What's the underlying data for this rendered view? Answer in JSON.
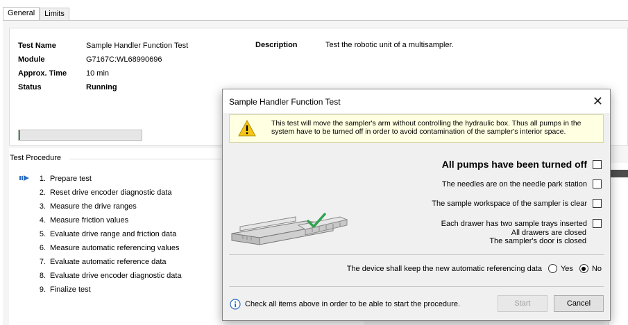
{
  "tabs": [
    {
      "label": "General",
      "active": true
    },
    {
      "label": "Limits",
      "active": false
    }
  ],
  "info": {
    "test_name_label": "Test Name",
    "test_name_value": "Sample Handler Function Test",
    "module_label": "Module",
    "module_value": "G7167C:WL68990696",
    "time_label": "Approx. Time",
    "time_value": "10 min",
    "status_label": "Status",
    "status_value": "Running",
    "description_label": "Description",
    "description_value": "Test the robotic unit of a multisampler.",
    "progress_fraction": 0.01
  },
  "procedure": {
    "title": "Test Procedure",
    "items": [
      {
        "num": "1.",
        "label": "Prepare test",
        "current": true
      },
      {
        "num": "2.",
        "label": "Reset drive encoder diagnostic data"
      },
      {
        "num": "3.",
        "label": "Measure the drive ranges"
      },
      {
        "num": "4.",
        "label": "Measure friction values"
      },
      {
        "num": "5.",
        "label": "Evaluate drive range and friction data"
      },
      {
        "num": "6.",
        "label": "Measure automatic referencing values"
      },
      {
        "num": "7.",
        "label": "Evaluate automatic reference data"
      },
      {
        "num": "8.",
        "label": "Evaluate drive encoder diagnostic data"
      },
      {
        "num": "9.",
        "label": "Finalize test"
      }
    ]
  },
  "dialog": {
    "title": "Sample Handler Function Test",
    "warning_line1": "This test will move the sampler's arm without controlling the hydraulic box. Thus all pumps in the",
    "warning_line2": "system have to be turned off in order to avoid contamination of the sampler's interior space.",
    "checks": {
      "pumps": "All pumps have been turned off",
      "needles": "The needles are on the needle park station",
      "workspace": "The sample workspace of the sampler is clear",
      "drawers": "Each drawer has two sample trays inserted",
      "drawers_closed": "All drawers are closed",
      "door_closed": "The sampler's door is closed"
    },
    "ref_question": "The device shall keep the new automatic referencing data",
    "yes_label": "Yes",
    "no_label": "No",
    "selected": "No",
    "footer_hint": "Check all items above in order to be able to start the procedure.",
    "start_label": "Start",
    "cancel_label": "Cancel"
  },
  "colors": {
    "progress": "#06b025",
    "warning_bg": "#ffffe1",
    "warning_icon": "#f5c518",
    "accent": "#2c6cc4"
  },
  "icons": {
    "warning": "warning-triangle-icon",
    "info": "info-icon",
    "current_step": "current-step-arrow-icon",
    "close": "close-icon"
  }
}
